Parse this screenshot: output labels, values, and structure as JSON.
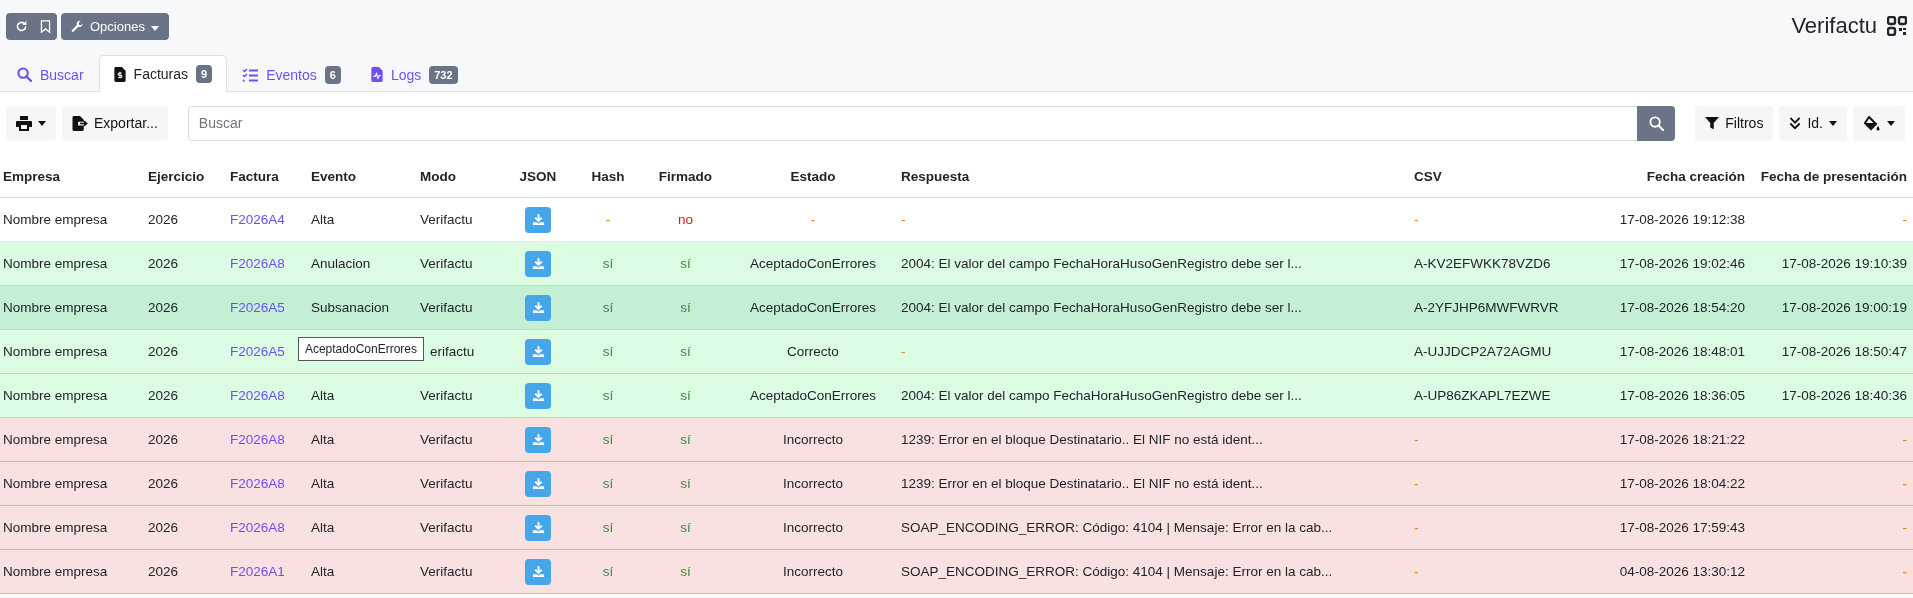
{
  "header": {
    "options_button": "Opciones",
    "app_title": "Verifactu"
  },
  "tabs": [
    {
      "kind": "search",
      "label": "Buscar",
      "selected": false
    },
    {
      "kind": "invoice",
      "label": "Facturas",
      "badge": "9",
      "selected": true
    },
    {
      "kind": "checklist",
      "label": "Eventos",
      "badge": "6",
      "selected": false
    },
    {
      "kind": "log",
      "label": "Logs",
      "badge": "732",
      "selected": false
    }
  ],
  "toolbar": {
    "export_button": "Exportar...",
    "search": {
      "placeholder": "Buscar"
    },
    "filters_button": "Filtros",
    "sort_button": "Id."
  },
  "table": {
    "columns": [
      "Empresa",
      "Ejercicio",
      "Factura",
      "Evento",
      "Modo",
      "JSON",
      "Hash",
      "Firmado",
      "Estado",
      "Respuesta",
      "CSV",
      "Fecha creación",
      "Fecha de presentación"
    ],
    "rows": [
      {
        "kind": "neutral",
        "selected": false,
        "empresa": "Nombre empresa",
        "ejercicio": "2026",
        "factura": "F2026A4",
        "evento": "Alta",
        "modo": "Verifactu",
        "hash": {
          "text": "-",
          "kind": "empty"
        },
        "firmado": {
          "text": "no",
          "kind": "no"
        },
        "estado": {
          "text": "-",
          "kind": "empty"
        },
        "respuesta": {
          "text": "-",
          "kind": "empty"
        },
        "csv": {
          "text": "-",
          "kind": "empty"
        },
        "fecha_creacion": "17-08-2026 19:12:38",
        "fecha_presentacion": {
          "text": "-",
          "kind": "empty"
        }
      },
      {
        "kind": "success",
        "selected": false,
        "empresa": "Nombre empresa",
        "ejercicio": "2026",
        "factura": "F2026A8",
        "evento": "Anulacion",
        "modo": "Verifactu",
        "hash": {
          "text": "sí",
          "kind": "yes"
        },
        "firmado": {
          "text": "sí",
          "kind": "yes"
        },
        "estado": {
          "text": "AceptadoConErrores",
          "kind": "plain"
        },
        "respuesta": {
          "text": "2004: El valor del campo FechaHoraHusoGenRegistro debe ser l...",
          "kind": "plain"
        },
        "csv": {
          "text": "A-KV2EFWKK78VZD6",
          "kind": "plain"
        },
        "fecha_creacion": "17-08-2026 19:02:46",
        "fecha_presentacion": {
          "text": "17-08-2026 19:10:39",
          "kind": "plain"
        }
      },
      {
        "kind": "success",
        "selected": true,
        "empresa": "Nombre empresa",
        "ejercicio": "2026",
        "factura": "F2026A5",
        "evento": "Subsanacion",
        "modo": "Verifactu",
        "hash": {
          "text": "sí",
          "kind": "yes"
        },
        "firmado": {
          "text": "sí",
          "kind": "yes"
        },
        "estado": {
          "text": "AceptadoConErrores",
          "kind": "plain"
        },
        "respuesta": {
          "text": "2004: El valor del campo FechaHoraHusoGenRegistro debe ser l...",
          "kind": "plain"
        },
        "csv": {
          "text": "A-2YFJHP6MWFWRVR",
          "kind": "plain"
        },
        "fecha_creacion": "17-08-2026 18:54:20",
        "fecha_presentacion": {
          "text": "17-08-2026 19:00:19",
          "kind": "plain"
        }
      },
      {
        "kind": "success",
        "selected": false,
        "empresa": "Nombre empresa",
        "ejercicio": "2026",
        "factura": "F2026A5",
        "tooltip": "AceptadoConErrores",
        "modo": "erifactu",
        "hash": {
          "text": "sí",
          "kind": "yes"
        },
        "firmado": {
          "text": "sí",
          "kind": "yes"
        },
        "estado": {
          "text": "Correcto",
          "kind": "plain"
        },
        "respuesta": {
          "text": "-",
          "kind": "empty"
        },
        "csv": {
          "text": "A-UJJDCP2A72AGMU",
          "kind": "plain"
        },
        "fecha_creacion": "17-08-2026 18:48:01",
        "fecha_presentacion": {
          "text": "17-08-2026 18:50:47",
          "kind": "plain"
        }
      },
      {
        "kind": "success",
        "selected": false,
        "empresa": "Nombre empresa",
        "ejercicio": "2026",
        "factura": "F2026A8",
        "evento": "Alta",
        "modo": "Verifactu",
        "hash": {
          "text": "sí",
          "kind": "yes"
        },
        "firmado": {
          "text": "sí",
          "kind": "yes"
        },
        "estado": {
          "text": "AceptadoConErrores",
          "kind": "plain"
        },
        "respuesta": {
          "text": "2004: El valor del campo FechaHoraHusoGenRegistro debe ser l...",
          "kind": "plain"
        },
        "csv": {
          "text": "A-UP86ZKAPL7EZWE",
          "kind": "plain"
        },
        "fecha_creacion": "17-08-2026 18:36:05",
        "fecha_presentacion": {
          "text": "17-08-2026 18:40:36",
          "kind": "plain"
        }
      },
      {
        "kind": "danger",
        "selected": false,
        "empresa": "Nombre empresa",
        "ejercicio": "2026",
        "factura": "F2026A8",
        "evento": "Alta",
        "modo": "Verifactu",
        "hash": {
          "text": "sí",
          "kind": "yes"
        },
        "firmado": {
          "text": "sí",
          "kind": "yes"
        },
        "estado": {
          "text": "Incorrecto",
          "kind": "plain"
        },
        "respuesta": {
          "text": "1239: Error en el bloque Destinatario.. El NIF no está ident...",
          "kind": "plain"
        },
        "csv": {
          "text": "-",
          "kind": "empty"
        },
        "fecha_creacion": "17-08-2026 18:21:22",
        "fecha_presentacion": {
          "text": "-",
          "kind": "empty"
        }
      },
      {
        "kind": "danger",
        "selected": false,
        "empresa": "Nombre empresa",
        "ejercicio": "2026",
        "factura": "F2026A8",
        "evento": "Alta",
        "modo": "Verifactu",
        "hash": {
          "text": "sí",
          "kind": "yes"
        },
        "firmado": {
          "text": "sí",
          "kind": "yes"
        },
        "estado": {
          "text": "Incorrecto",
          "kind": "plain"
        },
        "respuesta": {
          "text": "1239: Error en el bloque Destinatario.. El NIF no está ident...",
          "kind": "plain"
        },
        "csv": {
          "text": "-",
          "kind": "empty"
        },
        "fecha_creacion": "17-08-2026 18:04:22",
        "fecha_presentacion": {
          "text": "-",
          "kind": "empty"
        }
      },
      {
        "kind": "danger",
        "selected": false,
        "empresa": "Nombre empresa",
        "ejercicio": "2026",
        "factura": "F2026A8",
        "evento": "Alta",
        "modo": "Verifactu",
        "hash": {
          "text": "sí",
          "kind": "yes"
        },
        "firmado": {
          "text": "sí",
          "kind": "yes"
        },
        "estado": {
          "text": "Incorrecto",
          "kind": "plain"
        },
        "respuesta": {
          "text": "SOAP_ENCODING_ERROR: Código: 4104 | Mensaje: Error en la cab...",
          "kind": "plain"
        },
        "csv": {
          "text": "-",
          "kind": "empty"
        },
        "fecha_creacion": "17-08-2026 17:59:43",
        "fecha_presentacion": {
          "text": "-",
          "kind": "empty"
        }
      },
      {
        "kind": "danger",
        "selected": false,
        "empresa": "Nombre empresa",
        "ejercicio": "2026",
        "factura": "F2026A1",
        "evento": "Alta",
        "modo": "Verifactu",
        "hash": {
          "text": "sí",
          "kind": "yes"
        },
        "firmado": {
          "text": "sí",
          "kind": "yes"
        },
        "estado": {
          "text": "Incorrecto",
          "kind": "plain"
        },
        "respuesta": {
          "text": "SOAP_ENCODING_ERROR: Código: 4104 | Mensaje: Error en la cab...",
          "kind": "plain"
        },
        "csv": {
          "text": "-",
          "kind": "empty"
        },
        "fecha_creacion": "04-08-2026 13:30:12",
        "fecha_presentacion": {
          "text": "-",
          "kind": "empty"
        }
      }
    ]
  }
}
